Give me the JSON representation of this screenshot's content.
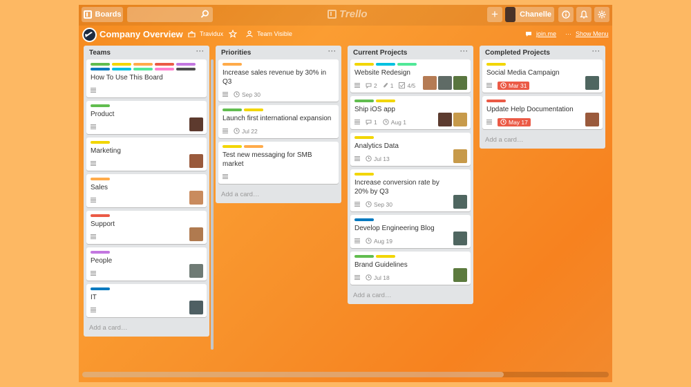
{
  "topbar": {
    "boards_label": "Boards",
    "logo_text": "Trello",
    "add_label": "+",
    "user_name": "Chanelle"
  },
  "board": {
    "title": "Company Overview",
    "team": "Travidux",
    "visibility": "Team Visible",
    "joinme": "join.me",
    "show_menu": "Show Menu"
  },
  "colors": {
    "green": "#61bd4f",
    "yellow": "#f2d600",
    "orange": "#ffab4a",
    "red": "#eb5a46",
    "purple": "#c377e0",
    "blue": "#0079bf",
    "sky": "#00c2e0",
    "lime": "#51e898",
    "pink": "#ff80ce",
    "black": "#4d4d4d",
    "due_red": "#eb5a46"
  },
  "add_card": "Add a card…",
  "lists": [
    {
      "title": "Teams",
      "cards": [
        {
          "labels": [
            "green",
            "yellow",
            "orange",
            "red",
            "purple",
            "blue",
            "sky",
            "lime",
            "pink",
            "black"
          ],
          "title": "How To Use This Board",
          "desc": true,
          "members": []
        },
        {
          "labels": [
            "green"
          ],
          "title": "Product",
          "desc": true,
          "members": [
            "#5d3a2e"
          ]
        },
        {
          "labels": [
            "yellow"
          ],
          "title": "Marketing",
          "desc": true,
          "members": [
            "#9a5a3c"
          ]
        },
        {
          "labels": [
            "orange"
          ],
          "title": "Sales",
          "desc": true,
          "members": [
            "#c98b5e"
          ]
        },
        {
          "labels": [
            "red"
          ],
          "title": "Support",
          "desc": true,
          "members": [
            "#b07a4f"
          ]
        },
        {
          "labels": [
            "purple"
          ],
          "title": "People",
          "desc": true,
          "members": [
            "#6f7b75"
          ]
        },
        {
          "labels": [
            "blue"
          ],
          "title": "IT",
          "desc": true,
          "members": [
            "#4e5f63"
          ]
        }
      ]
    },
    {
      "title": "Priorities",
      "cards": [
        {
          "labels": [
            "orange"
          ],
          "title": "Increase sales revenue by 30% in Q3",
          "desc": true,
          "due": "Sep 30",
          "members": []
        },
        {
          "labels": [
            "green",
            "yellow"
          ],
          "title": "Launch first international expansion",
          "desc": true,
          "due": "Jul 22",
          "members": []
        },
        {
          "labels": [
            "yellow",
            "orange"
          ],
          "title": "Test new messaging for SMB market",
          "desc": true,
          "members": []
        }
      ]
    },
    {
      "title": "Current Projects",
      "cards": [
        {
          "labels": [
            "yellow",
            "sky",
            "lime"
          ],
          "title": "Website Redesign",
          "desc": true,
          "comments": "2",
          "attachments": "1",
          "checklist": "4/5",
          "members": [
            "#b57b54",
            "#5f6b66",
            "#59763f"
          ]
        },
        {
          "labels": [
            "green",
            "yellow"
          ],
          "title": "Ship iOS app",
          "desc": true,
          "comments": "1",
          "due": "Aug 1",
          "members": [
            "#5c3b2f",
            "#c79a4a"
          ]
        },
        {
          "labels": [
            "yellow"
          ],
          "title": "Analytics Data",
          "desc": true,
          "due": "Jul 13",
          "members": [
            "#c79a4a"
          ]
        },
        {
          "labels": [
            "yellow"
          ],
          "title": "Increase conversion rate by 20% by Q3",
          "desc": true,
          "due": "Sep 30",
          "members": [
            "#4f6660"
          ]
        },
        {
          "labels": [
            "blue"
          ],
          "title": "Develop Engineering Blog",
          "desc": true,
          "due": "Aug 19",
          "members": [
            "#4f6660"
          ]
        },
        {
          "labels": [
            "green",
            "yellow"
          ],
          "title": "Brand Guidelines",
          "desc": true,
          "due": "Jul 18",
          "members": [
            "#5c7a3e"
          ]
        }
      ]
    },
    {
      "title": "Completed Projects",
      "cards": [
        {
          "labels": [
            "yellow"
          ],
          "title": "Social Media Campaign",
          "desc": true,
          "due": "Mar 31",
          "due_red": true,
          "members": [
            "#4f6660"
          ]
        },
        {
          "labels": [
            "red"
          ],
          "title": "Update Help Documentation",
          "desc": true,
          "due": "May 17",
          "due_red": true,
          "members": [
            "#9a5a3c"
          ]
        }
      ]
    }
  ]
}
